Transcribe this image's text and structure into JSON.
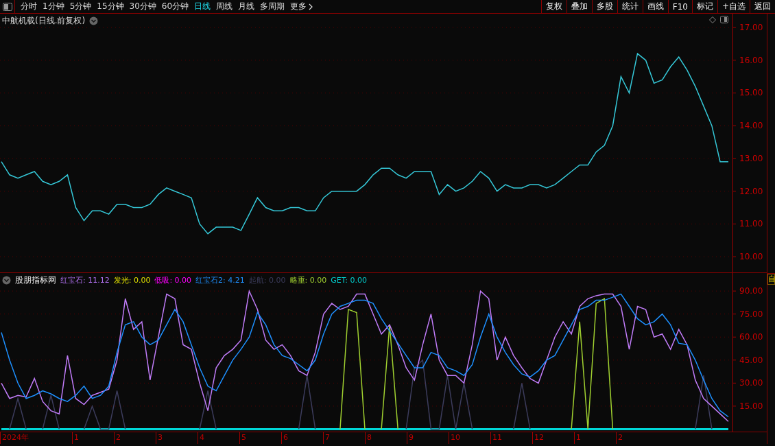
{
  "toolbar": {
    "periods": [
      {
        "label": "分时",
        "selected": false
      },
      {
        "label": "1分钟",
        "selected": false
      },
      {
        "label": "5分钟",
        "selected": false
      },
      {
        "label": "15分钟",
        "selected": false
      },
      {
        "label": "30分钟",
        "selected": false
      },
      {
        "label": "60分钟",
        "selected": false
      },
      {
        "label": "日线",
        "selected": true
      },
      {
        "label": "周线",
        "selected": false
      },
      {
        "label": "月线",
        "selected": false
      },
      {
        "label": "多周期",
        "selected": false
      },
      {
        "label": "更多",
        "selected": false
      }
    ],
    "actions": [
      "复权",
      "叠加",
      "多股",
      "统计",
      "画线",
      "F10",
      "标记",
      "+自选",
      "返回"
    ]
  },
  "price_pane": {
    "title": "中航机载(日线.前复权)",
    "chart_data": {
      "type": "line",
      "grid": true,
      "ylim": [
        9.52,
        17.42
      ],
      "yticks": [
        {
          "value": 10,
          "label": "10.00"
        },
        {
          "value": 11,
          "label": "11.00"
        },
        {
          "value": 12,
          "label": "12.00"
        },
        {
          "value": 13,
          "label": "13.00"
        },
        {
          "value": 14,
          "label": "14.00"
        },
        {
          "value": 15,
          "label": "15.00"
        },
        {
          "value": 16,
          "label": "16.00"
        },
        {
          "value": 17,
          "label": "17.00"
        }
      ],
      "series": [
        {
          "color": "#35c8d8",
          "values": [
            12.9,
            12.5,
            12.4,
            12.5,
            12.6,
            12.3,
            12.2,
            12.3,
            12.5,
            11.5,
            11.1,
            11.4,
            11.4,
            11.3,
            11.6,
            11.6,
            11.5,
            11.5,
            11.6,
            11.9,
            12.1,
            12.0,
            11.9,
            11.8,
            11.0,
            10.7,
            10.9,
            10.9,
            10.9,
            10.8,
            11.3,
            11.8,
            11.5,
            11.4,
            11.4,
            11.5,
            11.5,
            11.4,
            11.4,
            11.8,
            12.0,
            12.0,
            12.0,
            12.0,
            12.2,
            12.5,
            12.7,
            12.7,
            12.5,
            12.4,
            12.6,
            12.6,
            12.6,
            11.9,
            12.2,
            12.0,
            12.1,
            12.3,
            12.6,
            12.4,
            12.0,
            12.2,
            12.1,
            12.1,
            12.2,
            12.2,
            12.1,
            12.2,
            12.4,
            12.6,
            12.8,
            12.8,
            13.2,
            13.4,
            14.0,
            15.5,
            15.0,
            16.2,
            16.0,
            15.3,
            15.4,
            15.8,
            16.1,
            15.7,
            15.2,
            14.6,
            14.0,
            12.9,
            12.9
          ]
        }
      ]
    }
  },
  "lower_pane": {
    "indicator": "股朋指标网",
    "legend": [
      {
        "text": "红宝石: 11.12",
        "color": "#b070f0"
      },
      {
        "text": "发光: 0.00",
        "color": "#e0e000"
      },
      {
        "text": "低吸: 0.00",
        "color": "#ff00ff"
      },
      {
        "text": "红宝石2: 4.21",
        "color": "#1e90ff"
      },
      {
        "text": "起航: 0.00",
        "color": "#3c3c5c"
      },
      {
        "text": "略重: 0.00",
        "color": "#a0d030"
      },
      {
        "text": "GET: 0.00",
        "color": "#00d0d0"
      }
    ],
    "side_label": "自",
    "chart_data": {
      "type": "line",
      "grid": true,
      "ylim": [
        -1.6,
        101.7
      ],
      "yticks": [
        {
          "value": 15,
          "label": "15.00"
        },
        {
          "value": 30,
          "label": "30.00"
        },
        {
          "value": 45,
          "label": "45.00"
        },
        {
          "value": 60,
          "label": "60.00"
        },
        {
          "value": 75,
          "label": "75.00"
        },
        {
          "value": 90,
          "label": "90.00"
        }
      ],
      "series": [
        {
          "color": "#00d8d8",
          "values": [
            0,
            0,
            0,
            0,
            0,
            0,
            0,
            0,
            0,
            0,
            0,
            0,
            0,
            0,
            0,
            0,
            0,
            0,
            0,
            0,
            0,
            0,
            0,
            0,
            0,
            0,
            0,
            0,
            0,
            0,
            0,
            0,
            0,
            0,
            0,
            0,
            0,
            0,
            0,
            0,
            0,
            0,
            0,
            0,
            0,
            0,
            0,
            0,
            0,
            0,
            0,
            0,
            0,
            0,
            0,
            0,
            0,
            0,
            0,
            0,
            0,
            0,
            0,
            0,
            0,
            0,
            0,
            0,
            0,
            0,
            0,
            0,
            0,
            0,
            0,
            0,
            0,
            0,
            0,
            0,
            0,
            0,
            0,
            0,
            0,
            0,
            0,
            0,
            0
          ]
        },
        {
          "color": "#3c3c5c",
          "values": [
            null,
            0,
            20,
            0,
            null,
            0,
            22,
            0,
            null,
            null,
            0,
            15,
            0,
            0,
            25,
            0,
            null,
            null,
            null,
            null,
            null,
            null,
            null,
            null,
            0,
            25,
            0,
            null,
            null,
            null,
            null,
            null,
            null,
            null,
            null,
            null,
            0,
            35,
            0,
            null,
            null,
            null,
            null,
            null,
            null,
            null,
            null,
            null,
            null,
            0,
            40,
            45,
            0,
            0,
            35,
            0,
            30,
            0,
            null,
            null,
            null,
            null,
            0,
            30,
            0,
            null,
            null,
            null,
            null,
            null,
            null,
            null,
            null,
            null,
            null,
            null,
            null,
            null,
            null,
            null,
            null,
            null,
            null,
            null,
            0,
            35,
            0,
            null,
            null
          ]
        },
        {
          "color": "#a0d030",
          "values": [
            null,
            null,
            null,
            null,
            null,
            null,
            null,
            null,
            null,
            null,
            null,
            null,
            null,
            null,
            null,
            null,
            null,
            null,
            null,
            null,
            null,
            null,
            null,
            null,
            null,
            null,
            null,
            null,
            null,
            null,
            null,
            null,
            null,
            null,
            null,
            null,
            null,
            null,
            null,
            null,
            null,
            0,
            78,
            76,
            0,
            null,
            0,
            68,
            0,
            null,
            null,
            null,
            null,
            null,
            null,
            null,
            null,
            null,
            null,
            null,
            null,
            null,
            null,
            null,
            null,
            null,
            null,
            null,
            null,
            0,
            70,
            0,
            82,
            85,
            0,
            null,
            null,
            null,
            null,
            null,
            null,
            null,
            null,
            null,
            null,
            null,
            null,
            null,
            null
          ]
        },
        {
          "color": "#c07cf8",
          "values": [
            30,
            20,
            22,
            21,
            33,
            18,
            12,
            10,
            48,
            20,
            16,
            22,
            24,
            26,
            45,
            85,
            65,
            70,
            32,
            60,
            88,
            85,
            55,
            52,
            30,
            12,
            40,
            48,
            52,
            58,
            90,
            78,
            58,
            52,
            55,
            48,
            38,
            35,
            50,
            75,
            82,
            78,
            80,
            88,
            88,
            75,
            62,
            68,
            55,
            40,
            32,
            55,
            75,
            45,
            35,
            35,
            30,
            55,
            90,
            85,
            45,
            60,
            48,
            40,
            33,
            30,
            45,
            60,
            70,
            62,
            80,
            85,
            87,
            88,
            88,
            80,
            52,
            80,
            78,
            60,
            62,
            52,
            65,
            55,
            32,
            20,
            15,
            10,
            5
          ]
        },
        {
          "color": "#1e90ff",
          "values": [
            63,
            45,
            30,
            20,
            22,
            25,
            23,
            20,
            18,
            22,
            28,
            20,
            22,
            28,
            50,
            68,
            70,
            60,
            55,
            58,
            68,
            78,
            70,
            55,
            40,
            28,
            25,
            35,
            45,
            52,
            60,
            76,
            68,
            55,
            48,
            46,
            42,
            38,
            45,
            62,
            75,
            80,
            82,
            84,
            84,
            82,
            72,
            64,
            56,
            48,
            40,
            40,
            50,
            48,
            40,
            38,
            35,
            42,
            60,
            75,
            60,
            50,
            42,
            36,
            34,
            38,
            45,
            48,
            58,
            68,
            78,
            80,
            84,
            84,
            86,
            88,
            80,
            72,
            68,
            70,
            75,
            68,
            56,
            55,
            45,
            32,
            20,
            12,
            8
          ]
        }
      ]
    }
  },
  "date_axis": [
    "2024年",
    "1",
    "2",
    "3",
    "4",
    "5",
    "6",
    "7",
    "8",
    "9",
    "10",
    "11",
    "12",
    "1",
    "2"
  ]
}
